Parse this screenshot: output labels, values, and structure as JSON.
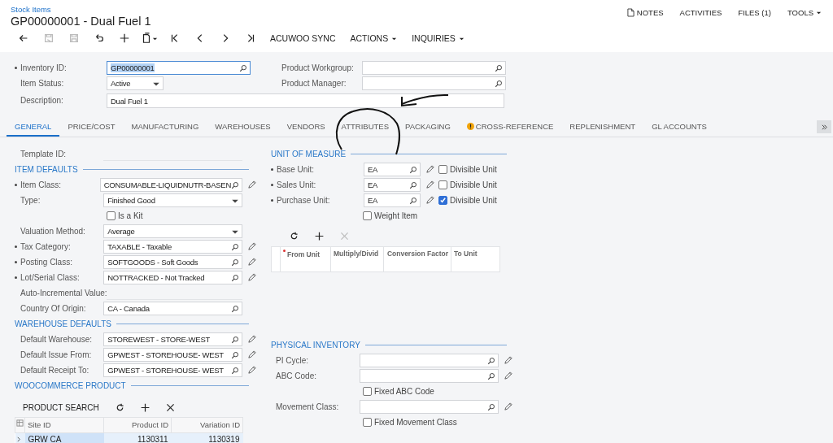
{
  "breadcrumb": "Stock Items",
  "title": "GP00000001 - Dual Fuel 1",
  "top_links": [
    {
      "label": "NOTES",
      "kind": "note"
    },
    {
      "label": "ACTIVITIES",
      "kind": "plain"
    },
    {
      "label": "FILES (1)",
      "kind": "plain"
    },
    {
      "label": "TOOLS",
      "kind": "menu"
    }
  ],
  "toolbar": [
    {
      "kind": "back",
      "disabled": false
    },
    {
      "kind": "save-close",
      "disabled": true
    },
    {
      "kind": "save",
      "disabled": true
    },
    {
      "kind": "undo",
      "disabled": false
    },
    {
      "kind": "add",
      "disabled": false
    },
    {
      "kind": "copy",
      "disabled": false
    },
    {
      "kind": "first",
      "disabled": false
    },
    {
      "kind": "prev",
      "disabled": false
    },
    {
      "kind": "next",
      "disabled": false
    },
    {
      "kind": "last",
      "disabled": false
    },
    {
      "kind": "text",
      "label": "ACUWOO SYNC",
      "disabled": false
    },
    {
      "kind": "menu",
      "label": "ACTIONS",
      "disabled": false
    },
    {
      "kind": "menu",
      "label": "INQUIRIES",
      "disabled": false
    }
  ],
  "header": {
    "inventory_id": {
      "label": "Inventory ID:",
      "required": true,
      "value": "GP00000001",
      "focused": true
    },
    "item_status": {
      "label": "Item Status:",
      "required": false,
      "value": "Active"
    },
    "description": {
      "label": "Description:",
      "required": false,
      "value": "Dual Fuel 1"
    },
    "product_workgroup": {
      "label": "Product Workgroup:",
      "required": false
    },
    "product_manager": {
      "label": "Product Manager:",
      "required": false
    }
  },
  "tabs": [
    {
      "label": "GENERAL",
      "selected": true,
      "warning": false
    },
    {
      "label": "PRICE/COST",
      "selected": false,
      "warning": false
    },
    {
      "label": "MANUFACTURING",
      "selected": false,
      "warning": false
    },
    {
      "label": "WAREHOUSES",
      "selected": false,
      "warning": false
    },
    {
      "label": "VENDORS",
      "selected": false,
      "warning": false
    },
    {
      "label": "ATTRIBUTES",
      "selected": false,
      "warning": false
    },
    {
      "label": "PACKAGING",
      "selected": false,
      "warning": false
    },
    {
      "label": "CROSS-REFERENCE",
      "selected": false,
      "warning": true
    },
    {
      "label": "REPLENISHMENT",
      "selected": false,
      "warning": false
    },
    {
      "label": "GL ACCOUNTS",
      "selected": false,
      "warning": false
    }
  ],
  "general": {
    "left": [
      {
        "rows": [
          {
            "kind": "empty",
            "label": "Template ID:",
            "required": false,
            "edit": false
          }
        ]
      },
      {
        "title": "ITEM DEFAULTS",
        "rows": [
          {
            "kind": "lookup",
            "label": "Item Class:",
            "required": true,
            "value": "CONSUMABLE-LIQUIDNUTR-BASEN",
            "edit": true
          },
          {
            "kind": "select",
            "label": "Type:",
            "required": false,
            "value": "Finished Good",
            "edit": false
          },
          {
            "kind": "checkbox",
            "label": "Is a Kit",
            "checked": false
          },
          {
            "kind": "select",
            "label": "Valuation Method:",
            "required": false,
            "value": "Average",
            "edit": false
          },
          {
            "kind": "lookup",
            "label": "Tax Category:",
            "required": true,
            "value": "TAXABLE - Taxable",
            "edit": true
          },
          {
            "kind": "lookup",
            "label": "Posting Class:",
            "required": true,
            "value": "SOFTGOODS - Soft Goods",
            "edit": true
          },
          {
            "kind": "lookup",
            "label": "Lot/Serial Class:",
            "required": true,
            "value": "NOTTRACKED - Not Tracked",
            "edit": true
          },
          {
            "kind": "empty",
            "label": "Auto-Incremental Value:",
            "required": false,
            "edit": false
          },
          {
            "kind": "lookup",
            "label": "Country Of Origin:",
            "required": false,
            "value": "CA - Canada",
            "edit": false
          }
        ]
      },
      {
        "title": "WAREHOUSE DEFAULTS",
        "rows": [
          {
            "kind": "lookup",
            "label": "Default Warehouse:",
            "required": false,
            "value": "STOREWEST - STORE-WEST",
            "edit": true
          },
          {
            "kind": "lookup",
            "label": "Default Issue From:",
            "required": false,
            "value": "GPWEST - STOREHOUSE- WEST",
            "edit": true
          },
          {
            "kind": "lookup",
            "label": "Default Receipt To:",
            "required": false,
            "value": "GPWEST - STOREHOUSE- WEST",
            "edit": true
          }
        ]
      },
      {
        "title": "WOOCOMMERCE PRODUCT",
        "grid": {
          "expandable": true,
          "toolbar": [
            {
              "kind": "text",
              "label": "PRODUCT SEARCH",
              "disabled": false
            },
            {
              "kind": "refresh",
              "disabled": false
            },
            {
              "kind": "add",
              "disabled": false
            },
            {
              "kind": "delete",
              "disabled": false
            }
          ],
          "columns": [
            {
              "label": "Site ID",
              "kind": "text",
              "required": false
            },
            {
              "label": "Product ID",
              "kind": "number",
              "required": false
            },
            {
              "label": "Variation ID",
              "kind": "number",
              "required": false
            }
          ],
          "rows": [
            {
              "selected": true,
              "cells": [
                "GRW CA",
                "1130311",
                "1130319"
              ]
            }
          ]
        }
      }
    ],
    "right": [
      {
        "title": "UNIT OF MEASURE",
        "rows": [
          {
            "kind": "lookup",
            "label": "Base Unit:",
            "required": true,
            "value": "EA",
            "edit": true,
            "check": {
              "label": "Divisible Unit",
              "checked": false
            }
          },
          {
            "kind": "lookup",
            "label": "Sales Unit:",
            "required": true,
            "value": "EA",
            "edit": true,
            "check": {
              "label": "Divisible Unit",
              "checked": false
            }
          },
          {
            "kind": "lookup",
            "label": "Purchase Unit:",
            "required": true,
            "value": "EA",
            "edit": true,
            "check": {
              "label": "Divisible Unit",
              "checked": true
            }
          },
          {
            "kind": "checkbox",
            "label": "Weight Item",
            "checked": false
          }
        ],
        "grid": {
          "expandable": false,
          "toolbar": [
            {
              "kind": "refresh",
              "disabled": false
            },
            {
              "kind": "add",
              "disabled": false
            },
            {
              "kind": "delete",
              "disabled": true
            }
          ],
          "columns": [
            {
              "label": "From Unit",
              "kind": "text",
              "required": true
            },
            {
              "label": "Multiply/Divid",
              "kind": "text",
              "required": false
            },
            {
              "label": "Conversion Factor",
              "kind": "number",
              "required": false
            },
            {
              "label": "To Unit",
              "kind": "text",
              "required": false
            }
          ]
        }
      },
      {
        "title": "PHYSICAL INVENTORY",
        "rows": [
          {
            "kind": "lookup",
            "label": "PI Cycle:",
            "required": false,
            "edit": true
          },
          {
            "kind": "lookup",
            "label": "ABC Code:",
            "required": false,
            "edit": true
          },
          {
            "kind": "checkbox",
            "label": "Fixed ABC Code",
            "checked": false
          },
          {
            "kind": "lookup",
            "label": "Movement Class:",
            "required": false,
            "edit": true
          },
          {
            "kind": "checkbox",
            "label": "Fixed Movement Class",
            "checked": false
          }
        ]
      }
    ]
  }
}
